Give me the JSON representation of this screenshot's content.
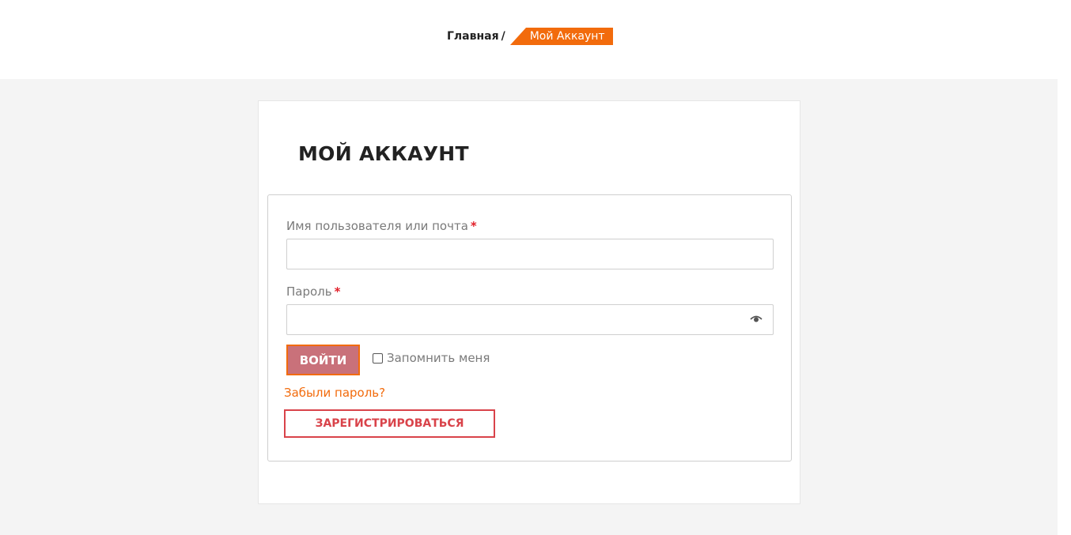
{
  "breadcrumb": {
    "home": "Главная",
    "separator": "/",
    "current": "Мой Аккаунт"
  },
  "page": {
    "title": "МОЙ АККАУНТ"
  },
  "login_form": {
    "username_label": "Имя пользователя или почта",
    "username_value": "",
    "password_label": "Пароль",
    "password_value": "",
    "required_mark": "*",
    "password_toggle_icon": "eye-icon",
    "login_button": "ВОЙТИ",
    "remember_label": "Запомнить меня",
    "remember_checked": false,
    "forgot_link": "Забыли пароль?",
    "register_button": "ЗАРЕГИСТРИРОВАТЬСЯ"
  },
  "colors": {
    "accent": "#f26b0c",
    "login_button_bg": "#c9717a",
    "register_border": "#d9434a",
    "required": "#e2202a",
    "content_bg": "#f4f4f4"
  }
}
